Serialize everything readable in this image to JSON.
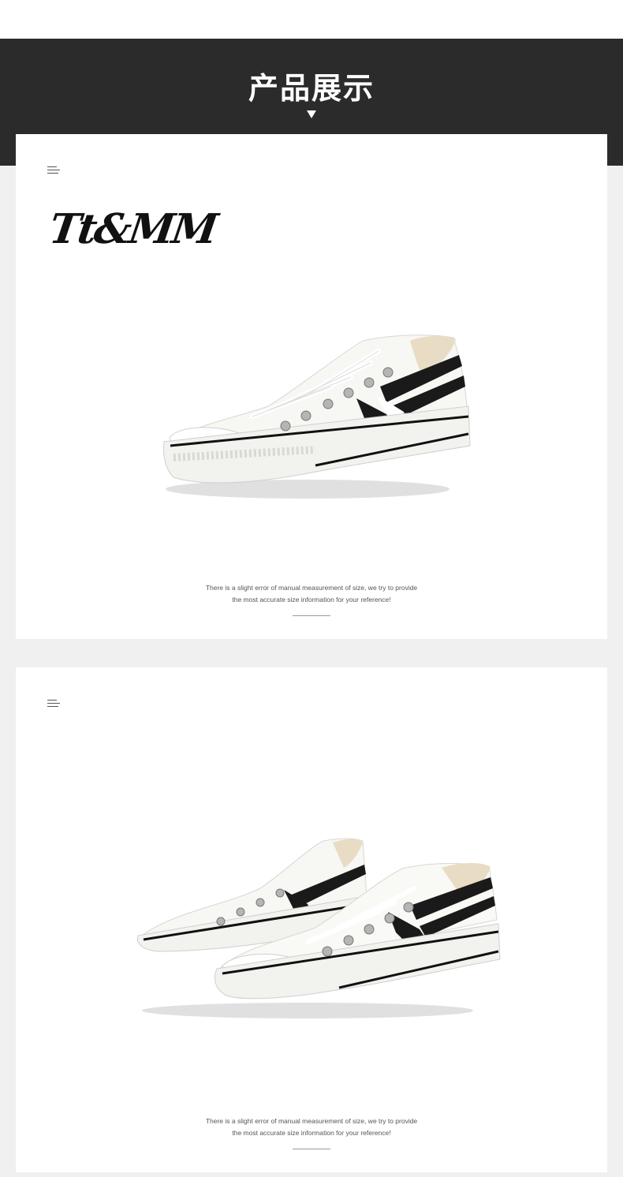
{
  "header": {
    "title": "产品展示"
  },
  "brand": {
    "logo_text": "Tt&MM"
  },
  "cards": [
    {
      "note_line1": "There is a slight error of manual measurement of size, we try to provide",
      "note_line2": "the most accurate size information for your reference!"
    },
    {
      "note_line1": "There is a slight error of manual measurement of size, we try to provide",
      "note_line2": "the most accurate size information for your reference!"
    }
  ],
  "colors": {
    "header_bg": "#2b2b2b",
    "page_bg": "#f0f0f0",
    "card_bg": "#ffffff"
  }
}
